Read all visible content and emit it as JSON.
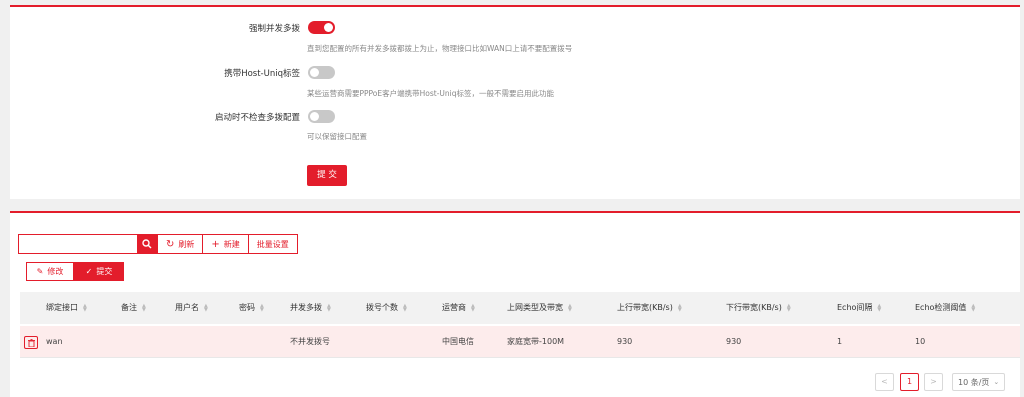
{
  "settings": {
    "force_concurrent": {
      "label": "强制并发多拨",
      "hint": "直到您配置的所有并发多拨都拨上为止，物理接口比如WAN口上请不要配置拨号",
      "on": true
    },
    "host_uniq": {
      "label": "携带Host-Uniq标签",
      "hint": "某些运营商需要PPPoE客户端携带Host-Uniq标签，一般不需要启用此功能",
      "on": false
    },
    "skip_check": {
      "label": "启动时不检查多拨配置",
      "hint": "可以保留接口配置",
      "on": false
    },
    "submit_label": "提 交"
  },
  "toolbar": {
    "search_placeholder": "",
    "refresh_label": "刷新",
    "new_label": "新建",
    "batch_label": "批量设置",
    "edit_label": "修改",
    "commit_label": "提交"
  },
  "table": {
    "headers": [
      "绑定接口",
      "备注",
      "用户名",
      "密码",
      "并发多拨",
      "拨号个数",
      "运营商",
      "上网类型及带宽",
      "上行带宽(KB/s)",
      "下行带宽(KB/s)",
      "Echo间隔",
      "Echo检测阈值"
    ],
    "rows": [
      [
        "wan",
        "",
        "",
        "",
        "不并发拨号",
        "",
        "中国电信",
        "家庭宽带-100M",
        "930",
        "930",
        "1",
        "10"
      ]
    ]
  },
  "pagination": {
    "prev": "<",
    "current_page": "1",
    "next": ">",
    "page_size": "10 条/页"
  },
  "colors": {
    "accent": "#e31d2b"
  }
}
